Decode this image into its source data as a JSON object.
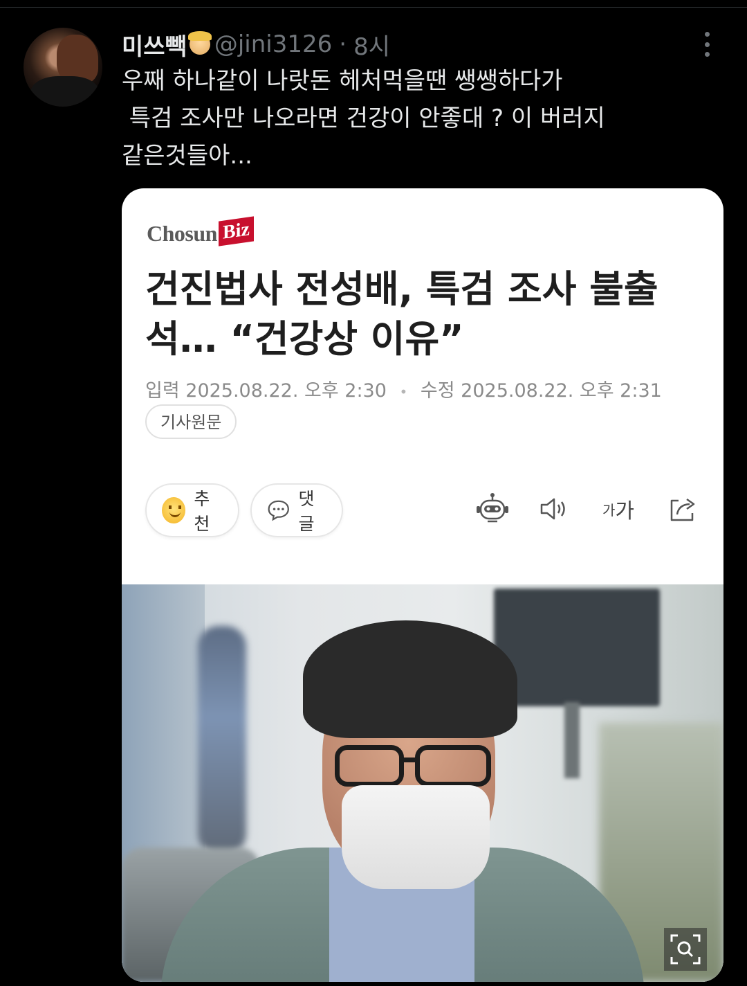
{
  "tweet": {
    "display_name": "미쓰빽",
    "handle": "@jini3126",
    "separator": "·",
    "time": "8시",
    "text_lines": [
      "우째 하나같이 나랏돈 헤처먹을땐 쌩쌩하다가",
      " 특검 조사만 나오라면 건강이 안좋대 ? 이 버러지",
      "같은것들아..."
    ]
  },
  "card": {
    "logo_text": "Chosun",
    "logo_badge": "Biz",
    "headline_lines": [
      "건진법사 전성배, 특검 조사 불출",
      "석… “건강상 이유”"
    ],
    "input_label": "입력 2025.08.22. 오후 2:30",
    "separator": "•",
    "edit_label": "수정 2025.08.22. 오후 2:31",
    "source_chip": "기사원문",
    "like_label": "추천",
    "comment_label": "댓글",
    "font_tool_small": "가",
    "font_tool_large": "가"
  },
  "icons": {
    "more": "more-vertical-icon",
    "like": "smile-emoji-icon",
    "comment": "speech-bubble-icon",
    "summary": "robot-icon",
    "audio": "speaker-icon",
    "font": "font-size-icon",
    "share": "share-icon",
    "zoom": "zoom-icon"
  },
  "colors": {
    "background": "#000000",
    "text": "#e7e9ea",
    "secondary_text": "#71767b",
    "card_background": "#ffffff",
    "brand_red": "#c8102e"
  }
}
